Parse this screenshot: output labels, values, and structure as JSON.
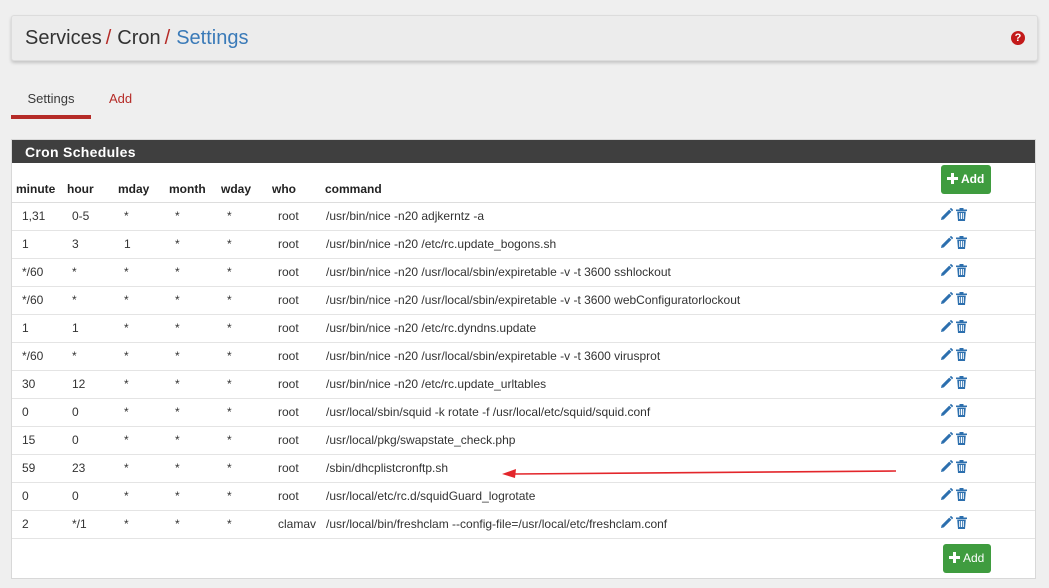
{
  "breadcrumb": {
    "items": [
      "Services",
      "Cron",
      "Settings"
    ],
    "separator": "/"
  },
  "help_icon": "question-circle-icon",
  "tabs": [
    {
      "label": "Settings",
      "active": true
    },
    {
      "label": "Add",
      "active": false
    }
  ],
  "panel": {
    "title": "Cron Schedules",
    "add_label": "Add",
    "columns": [
      "minute",
      "hour",
      "mday",
      "month",
      "wday",
      "who",
      "command"
    ],
    "rows": [
      {
        "minute": "1,31",
        "hour": "0-5",
        "mday": "*",
        "month": "*",
        "wday": "*",
        "who": "root",
        "command": "/usr/bin/nice -n20 adjkerntz -a"
      },
      {
        "minute": "1",
        "hour": "3",
        "mday": "1",
        "month": "*",
        "wday": "*",
        "who": "root",
        "command": "/usr/bin/nice -n20 /etc/rc.update_bogons.sh"
      },
      {
        "minute": "*/60",
        "hour": "*",
        "mday": "*",
        "month": "*",
        "wday": "*",
        "who": "root",
        "command": "/usr/bin/nice -n20 /usr/local/sbin/expiretable -v -t 3600 sshlockout"
      },
      {
        "minute": "*/60",
        "hour": "*",
        "mday": "*",
        "month": "*",
        "wday": "*",
        "who": "root",
        "command": "/usr/bin/nice -n20 /usr/local/sbin/expiretable -v -t 3600 webConfiguratorlockout"
      },
      {
        "minute": "1",
        "hour": "1",
        "mday": "*",
        "month": "*",
        "wday": "*",
        "who": "root",
        "command": "/usr/bin/nice -n20 /etc/rc.dyndns.update"
      },
      {
        "minute": "*/60",
        "hour": "*",
        "mday": "*",
        "month": "*",
        "wday": "*",
        "who": "root",
        "command": "/usr/bin/nice -n20 /usr/local/sbin/expiretable -v -t 3600 virusprot"
      },
      {
        "minute": "30",
        "hour": "12",
        "mday": "*",
        "month": "*",
        "wday": "*",
        "who": "root",
        "command": "/usr/bin/nice -n20 /etc/rc.update_urltables"
      },
      {
        "minute": "0",
        "hour": "0",
        "mday": "*",
        "month": "*",
        "wday": "*",
        "who": "root",
        "command": "/usr/local/sbin/squid -k rotate -f /usr/local/etc/squid/squid.conf"
      },
      {
        "minute": "15",
        "hour": "0",
        "mday": "*",
        "month": "*",
        "wday": "*",
        "who": "root",
        "command": "/usr/local/pkg/swapstate_check.php"
      },
      {
        "minute": "59",
        "hour": "23",
        "mday": "*",
        "month": "*",
        "wday": "*",
        "who": "root",
        "command": "/sbin/dhcplistcronftp.sh"
      },
      {
        "minute": "0",
        "hour": "0",
        "mday": "*",
        "month": "*",
        "wday": "*",
        "who": "root",
        "command": "/usr/local/etc/rc.d/squidGuard_logrotate"
      },
      {
        "minute": "2",
        "hour": "*/1",
        "mday": "*",
        "month": "*",
        "wday": "*",
        "who": "clamav",
        "command": "/usr/local/bin/freshclam --config-file=/usr/local/etc/freshclam.conf"
      }
    ]
  },
  "colors": {
    "accent_red": "#b52b27",
    "link_blue": "#3a7ab8",
    "add_green": "#3f9c3f",
    "icon_blue": "#2c6fae",
    "panel_heading": "#3f3f3f"
  }
}
